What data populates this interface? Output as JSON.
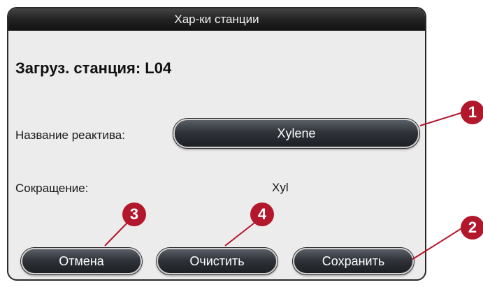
{
  "dialog": {
    "title": "Хар-ки станции",
    "station_title": "Загруз. станция: L04",
    "reagent_name_label": "Название реактива:",
    "reagent_name_value": "Xylene",
    "abbreviation_label": "Сокращение:",
    "abbreviation_value": "Xyl",
    "cancel_label": "Отмена",
    "clear_label": "Очистить",
    "save_label": "Сохранить"
  },
  "callouts": [
    "1",
    "2",
    "3",
    "4"
  ],
  "colors": {
    "callout": "#b3172c",
    "titlebar": "#232323",
    "panel": "#ececec"
  }
}
